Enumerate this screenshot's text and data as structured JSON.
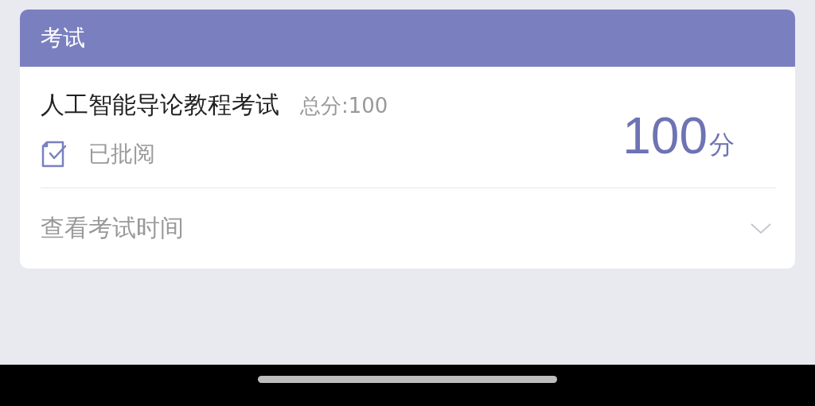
{
  "card": {
    "header": "考试",
    "exam_title": "人工智能导论教程考试",
    "total": "总分:100",
    "status": "已批阅",
    "score": "100",
    "score_unit": "分",
    "time_toggle": {
      "label": "查看考试时间",
      "expanded": false
    }
  }
}
